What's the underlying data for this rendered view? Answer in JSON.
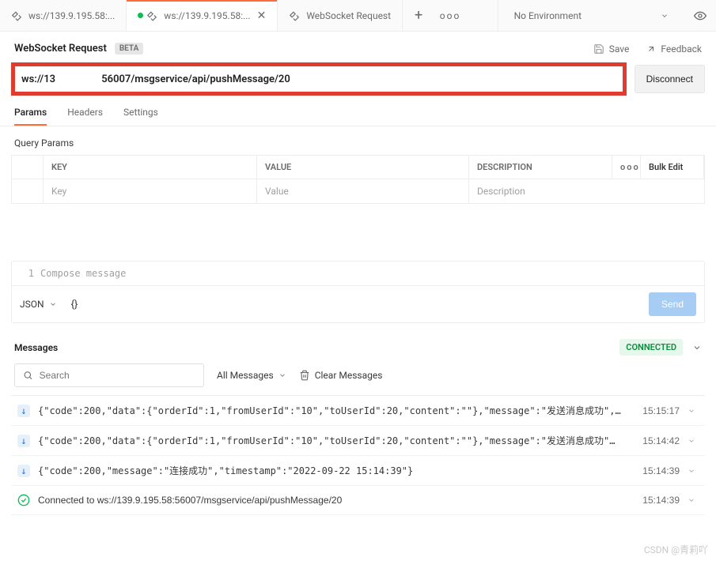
{
  "tabs": {
    "t0": "ws://139.9.195.58:...",
    "t1": "ws://139.9.195.58:...",
    "t2": "WebSocket Request",
    "add": "+",
    "more": "ooo",
    "env": "No Environment"
  },
  "header": {
    "title": "WebSocket Request",
    "beta": "BETA",
    "save": "Save",
    "feedback": "Feedback"
  },
  "url": {
    "value": "ws://13                  56007/msgservice/api/pushMessage/20",
    "disconnect": "Disconnect"
  },
  "subtabs": {
    "params": "Params",
    "headers": "Headers",
    "settings": "Settings"
  },
  "qp": {
    "section": "Query Params",
    "h_key": "KEY",
    "h_val": "VALUE",
    "h_desc": "DESCRIPTION",
    "h_more": "ooo",
    "h_bulk": "Bulk Edit",
    "p_key": "Key",
    "p_val": "Value",
    "p_desc": "Description"
  },
  "compose": {
    "ln": "1",
    "placeholder": "Compose message",
    "fmt": "JSON",
    "braces": "{}",
    "send": "Send"
  },
  "messages": {
    "title": "Messages",
    "status": "CONNECTED",
    "search_ph": "Search",
    "filter": "All Messages",
    "clear": "Clear Messages",
    "rows": [
      {
        "kind": "down",
        "text": "{\"code\":200,\"data\":{\"orderId\":1,\"fromUserId\":\"10\",\"toUserId\":20,\"content\":\"\"},\"message\":\"发送消息成功\",…",
        "time": "15:15:17"
      },
      {
        "kind": "down",
        "text": "{\"code\":200,\"data\":{\"orderId\":1,\"fromUserId\":\"10\",\"toUserId\":20,\"content\":\"\"},\"message\":\"发送消息成功\"…",
        "time": "15:14:42"
      },
      {
        "kind": "down",
        "text": "{\"code\":200,\"message\":\"连接成功\",\"timestamp\":\"2022-09-22 15:14:39\"}",
        "time": "15:14:39"
      },
      {
        "kind": "ok",
        "text": "Connected to ws://139.9.195.58:56007/msgservice/api/pushMessage/20",
        "time": "15:14:39"
      }
    ]
  },
  "watermark": "CSDN @青莉吖"
}
